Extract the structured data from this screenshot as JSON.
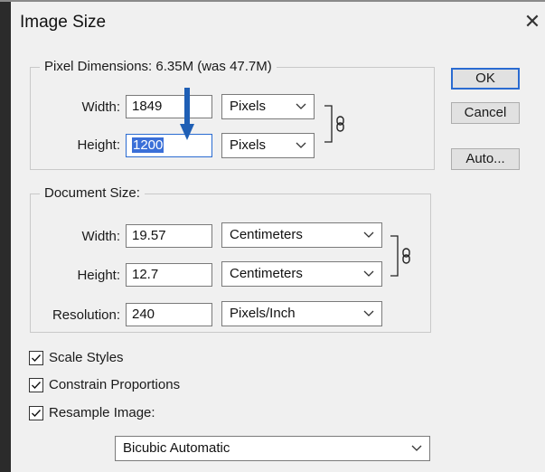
{
  "dialog": {
    "title": "Image Size",
    "close_glyph": "✕"
  },
  "pixel_dimensions": {
    "legend": "Pixel Dimensions:  6.35M (was 47.7M)",
    "width": {
      "label": "Width:",
      "value": "1849",
      "unit": "Pixels"
    },
    "height": {
      "label": "Height:",
      "value": "1200",
      "unit": "Pixels",
      "selected": true
    }
  },
  "document_size": {
    "legend": "Document Size:",
    "width": {
      "label": "Width:",
      "value": "19.57",
      "unit": "Centimeters"
    },
    "height": {
      "label": "Height:",
      "value": "12.7",
      "unit": "Centimeters"
    },
    "resolution": {
      "label": "Resolution:",
      "value": "240",
      "unit": "Pixels/Inch"
    }
  },
  "buttons": {
    "ok": "OK",
    "cancel": "Cancel",
    "auto": "Auto..."
  },
  "options": {
    "scale_styles": {
      "label": "Scale Styles",
      "checked": true
    },
    "constrain_proportions": {
      "label": "Constrain Proportions",
      "checked": true
    },
    "resample_image": {
      "label": "Resample Image:",
      "checked": true
    }
  },
  "resample_method": "Bicubic Automatic",
  "icons": {
    "link": "chain-link-icon",
    "dropdown": "chevron-down-icon",
    "annotation": "down-arrow-icon"
  },
  "colors": {
    "selection": "#3a6fd8",
    "focus": "#2a6bd1",
    "annotation_arrow": "#1f5fb5"
  }
}
